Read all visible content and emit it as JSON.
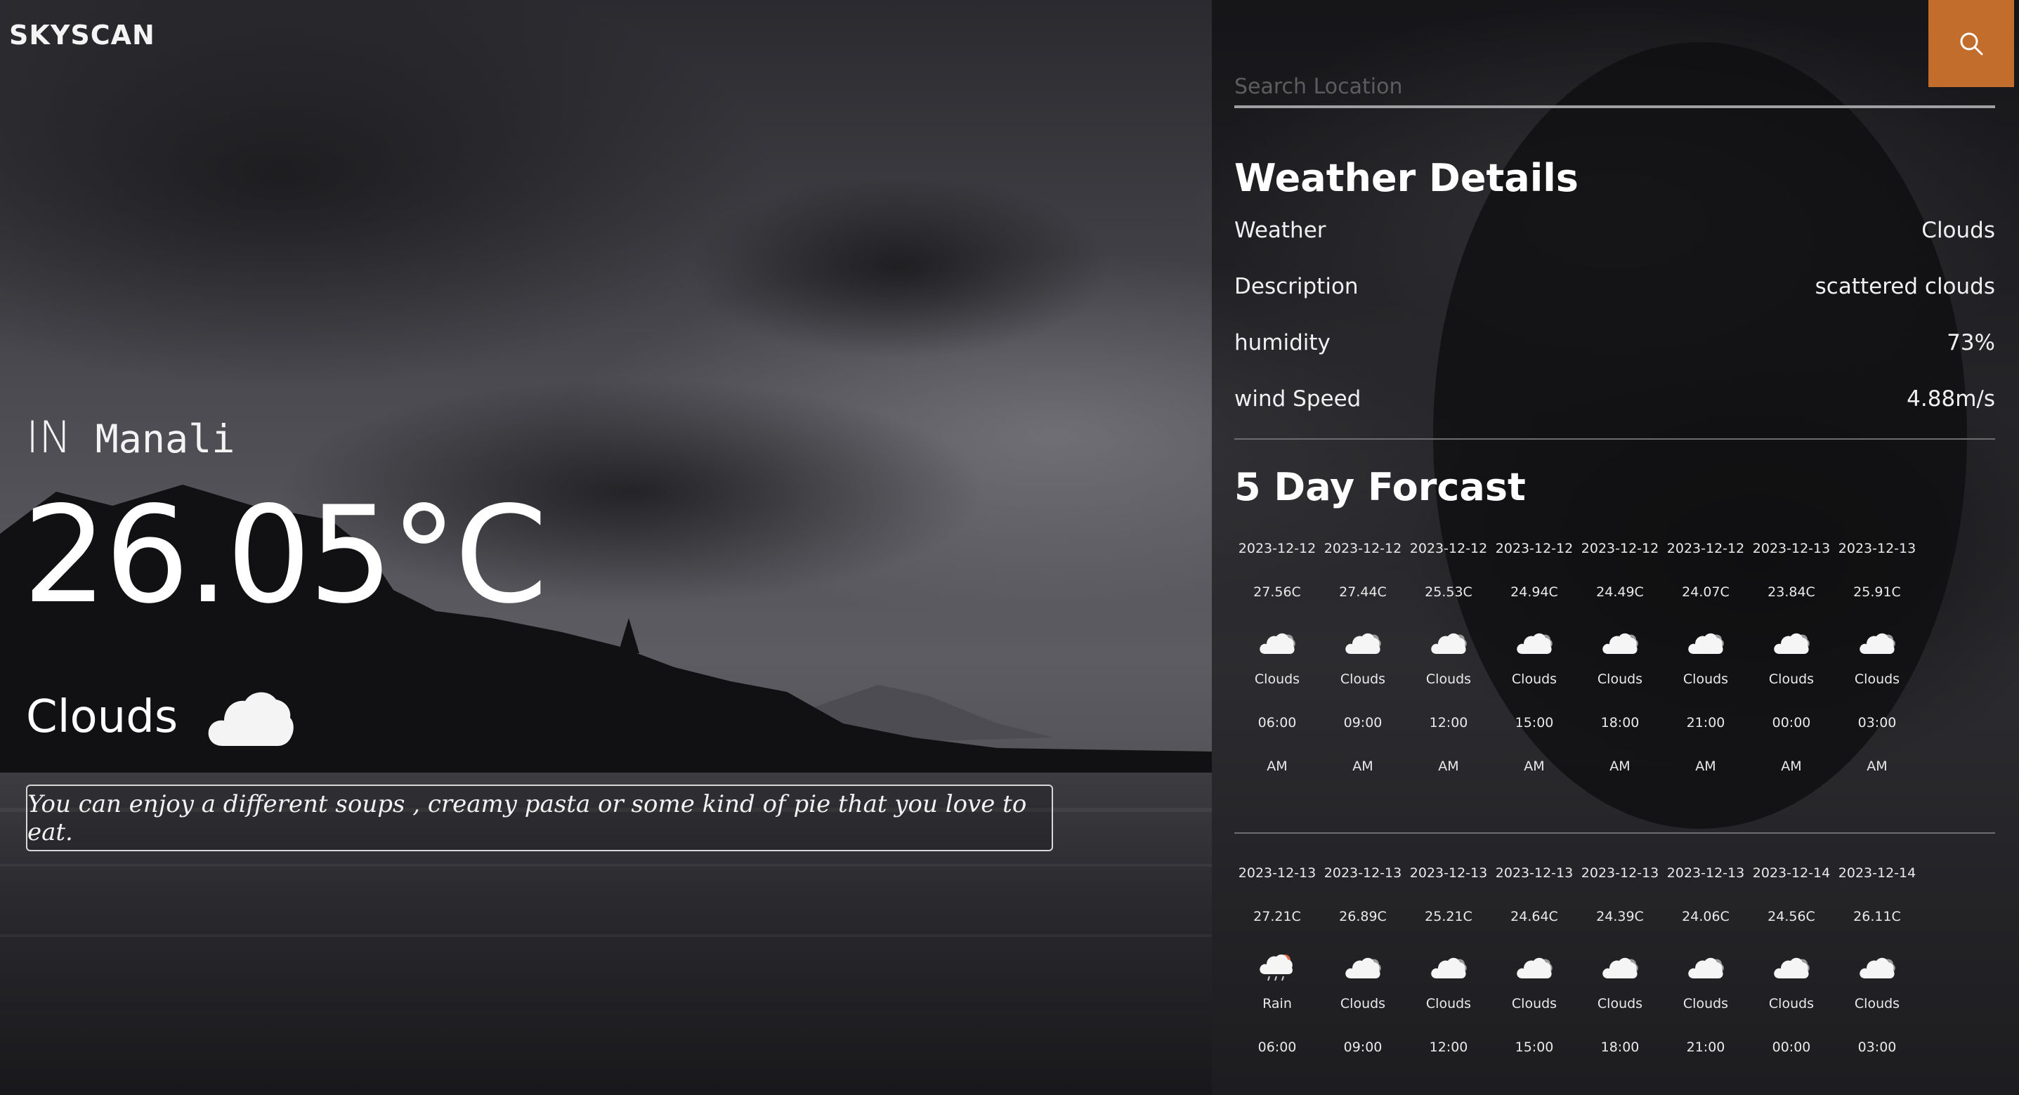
{
  "app": {
    "brand": "SKYSCAN"
  },
  "current": {
    "country": "IN",
    "city": "Manali",
    "temperature": "26.05°C",
    "condition": "Clouds",
    "condition_icon": "cloud-icon",
    "tip": "You can enjoy a different soups , creamy pasta or some kind of pie that you love to eat."
  },
  "search": {
    "placeholder": "Search Location",
    "value": "",
    "button_icon": "search-icon"
  },
  "details": {
    "heading": "Weather Details",
    "rows": [
      {
        "label": "Weather",
        "value": "Clouds"
      },
      {
        "label": "Description",
        "value": "scattered clouds"
      },
      {
        "label": "humidity",
        "value": "73%"
      },
      {
        "label": "wind Speed",
        "value": "4.88m/s"
      }
    ]
  },
  "forecast": {
    "heading": "5 Day Forcast",
    "rows": [
      [
        {
          "date": "2023-12-12",
          "temp": "27.56C",
          "icon": "clouds-icon",
          "cond": "Clouds",
          "time": "06:00",
          "ampm": "AM"
        },
        {
          "date": "2023-12-12",
          "temp": "27.44C",
          "icon": "clouds-icon",
          "cond": "Clouds",
          "time": "09:00",
          "ampm": "AM"
        },
        {
          "date": "2023-12-12",
          "temp": "25.53C",
          "icon": "clouds-icon",
          "cond": "Clouds",
          "time": "12:00",
          "ampm": "AM"
        },
        {
          "date": "2023-12-12",
          "temp": "24.94C",
          "icon": "clouds-icon",
          "cond": "Clouds",
          "time": "15:00",
          "ampm": "AM"
        },
        {
          "date": "2023-12-12",
          "temp": "24.49C",
          "icon": "clouds-icon",
          "cond": "Clouds",
          "time": "18:00",
          "ampm": "AM"
        },
        {
          "date": "2023-12-12",
          "temp": "24.07C",
          "icon": "clouds-icon",
          "cond": "Clouds",
          "time": "21:00",
          "ampm": "AM"
        },
        {
          "date": "2023-12-13",
          "temp": "23.84C",
          "icon": "clouds-icon",
          "cond": "Clouds",
          "time": "00:00",
          "ampm": "AM"
        },
        {
          "date": "2023-12-13",
          "temp": "25.91C",
          "icon": "clouds-icon",
          "cond": "Clouds",
          "time": "03:00",
          "ampm": "AM"
        }
      ],
      [
        {
          "date": "2023-12-13",
          "temp": "27.21C",
          "icon": "rain-icon",
          "cond": "Rain",
          "time": "06:00"
        },
        {
          "date": "2023-12-13",
          "temp": "26.89C",
          "icon": "clouds-icon",
          "cond": "Clouds",
          "time": "09:00"
        },
        {
          "date": "2023-12-13",
          "temp": "25.21C",
          "icon": "clouds-icon",
          "cond": "Clouds",
          "time": "12:00"
        },
        {
          "date": "2023-12-13",
          "temp": "24.64C",
          "icon": "clouds-icon",
          "cond": "Clouds",
          "time": "15:00"
        },
        {
          "date": "2023-12-13",
          "temp": "24.39C",
          "icon": "clouds-icon",
          "cond": "Clouds",
          "time": "18:00"
        },
        {
          "date": "2023-12-13",
          "temp": "24.06C",
          "icon": "clouds-icon",
          "cond": "Clouds",
          "time": "21:00"
        },
        {
          "date": "2023-12-14",
          "temp": "24.56C",
          "icon": "clouds-icon",
          "cond": "Clouds",
          "time": "00:00"
        },
        {
          "date": "2023-12-14",
          "temp": "26.11C",
          "icon": "clouds-icon",
          "cond": "Clouds",
          "time": "03:00"
        }
      ]
    ]
  },
  "colors": {
    "accent": "#c36d2c",
    "panel": "#0a0a0c",
    "text": "#ffffff"
  }
}
